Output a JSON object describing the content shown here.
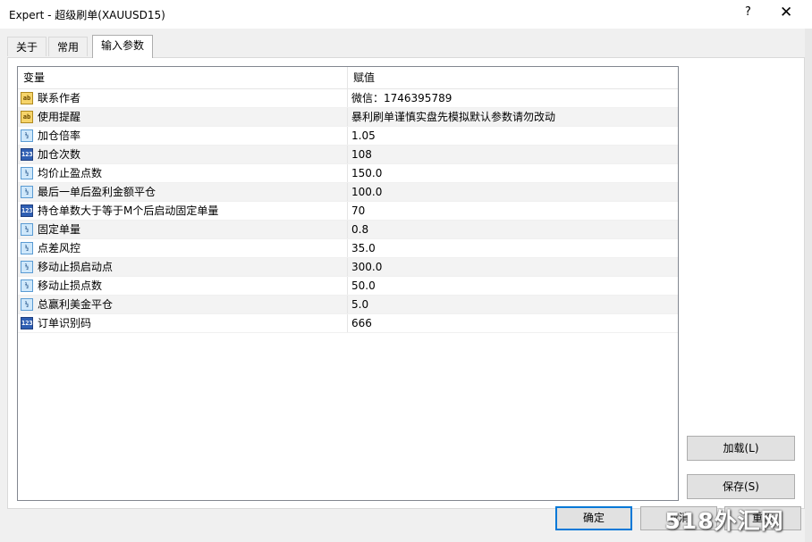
{
  "window": {
    "title": "Expert - 超级刷单(XAUUSD15)",
    "help_glyph": "?",
    "close_glyph": "✕"
  },
  "tabs": [
    {
      "label": "关于",
      "active": false
    },
    {
      "label": "常用",
      "active": false
    },
    {
      "label": "输入参数",
      "active": true
    }
  ],
  "grid": {
    "headers": {
      "variable": "变量",
      "value": "赋值"
    },
    "rows": [
      {
        "type": "string",
        "icon": "ab",
        "name": "联系作者",
        "value": "微信：1746395789"
      },
      {
        "type": "string",
        "icon": "ab",
        "name": "使用提醒",
        "value": "暴利刷单谨慎实盘先模拟默认参数请勿改动"
      },
      {
        "type": "double",
        "icon": "½",
        "name": "加仓倍率",
        "value": "1.05"
      },
      {
        "type": "int",
        "icon": "123",
        "name": "加仓次数",
        "value": "108"
      },
      {
        "type": "double",
        "icon": "½",
        "name": "均价止盈点数",
        "value": "150.0"
      },
      {
        "type": "double",
        "icon": "½",
        "name": "最后一单后盈利金额平仓",
        "value": "100.0"
      },
      {
        "type": "int",
        "icon": "123",
        "name": "持仓单数大于等于M个后启动固定单量",
        "value": "70"
      },
      {
        "type": "double",
        "icon": "½",
        "name": "固定单量",
        "value": "0.8"
      },
      {
        "type": "double",
        "icon": "½",
        "name": "点差风控",
        "value": "35.0"
      },
      {
        "type": "double",
        "icon": "½",
        "name": "移动止损启动点",
        "value": "300.0"
      },
      {
        "type": "double",
        "icon": "½",
        "name": "移动止损点数",
        "value": "50.0"
      },
      {
        "type": "double",
        "icon": "½",
        "name": "总赢利美金平仓",
        "value": "5.0"
      },
      {
        "type": "int",
        "icon": "123",
        "name": "订单识别码",
        "value": "666"
      }
    ]
  },
  "buttons": {
    "load": "加载(L)",
    "save": "保存(S)",
    "ok": "确定",
    "cancel": "取消",
    "reset": "重设"
  },
  "watermark": "518外汇网",
  "colors": {
    "accent": "#0078d7",
    "dialog_bg": "#f0f0f0"
  }
}
